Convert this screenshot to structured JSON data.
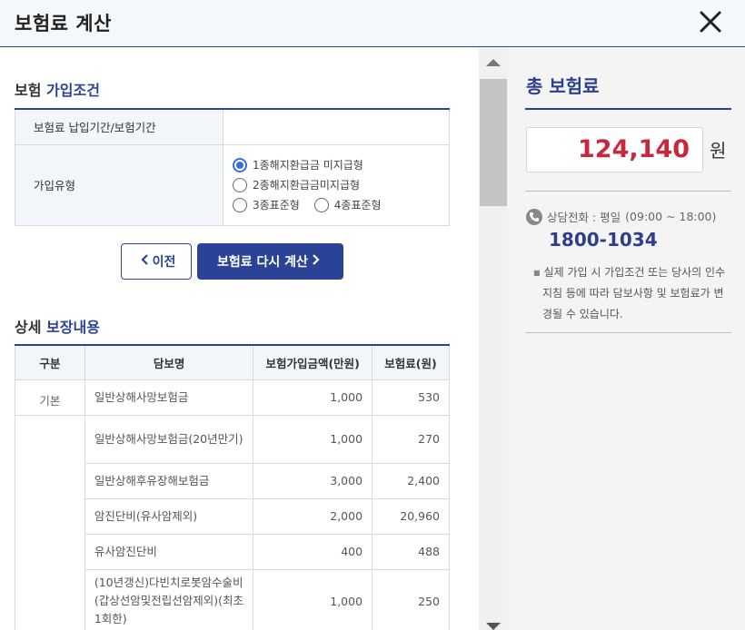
{
  "header": {
    "title": "보험료 계산"
  },
  "conditions": {
    "title_prefix": "보험",
    "title_accent": "가입조건",
    "period_label": "보험료 납입기간/보험기간",
    "period_value": "",
    "type_label": "가입유형",
    "options": [
      {
        "label": "1종해지환급금 미지급형",
        "checked": true
      },
      {
        "label": "2종해지환급금미지급형",
        "checked": false
      },
      {
        "label": "3종표준형",
        "checked": false
      },
      {
        "label": "4종표준형",
        "checked": false
      }
    ]
  },
  "buttons": {
    "prev": "이전",
    "recalc": "보험료 다시 계산"
  },
  "detail": {
    "title_prefix": "상세",
    "title_accent": "보장내용",
    "headers": [
      "구분",
      "담보명",
      "보험가입금액(만원)",
      "보험료(원)"
    ],
    "rows": [
      {
        "category": "기본",
        "name": "일반상해사망보험금",
        "amount": "1,000",
        "premium": "530"
      },
      {
        "category": "",
        "name": "일반상해사망보험금(20년만기)",
        "amount": "1,000",
        "premium": "270"
      },
      {
        "category": "",
        "name": "일반상해후유장해보험금",
        "amount": "3,000",
        "premium": "2,400"
      },
      {
        "category": "",
        "name": "암진단비(유사암제외)",
        "amount": "2,000",
        "premium": "20,960"
      },
      {
        "category": "",
        "name": "유사암진단비",
        "amount": "400",
        "premium": "488"
      },
      {
        "category": "",
        "name": "(10년갱신)다빈치로봇암수술비(갑상선암및전립선암제외)(최초1회한)",
        "amount": "1,000",
        "premium": "250"
      }
    ]
  },
  "summary": {
    "title": "총 보험료",
    "amount": "124,140",
    "unit": "원",
    "phone_label": "상담전화 : 평일",
    "phone_hours": "(09:00 ~ 18:00)",
    "phone_number": "1800-1034",
    "notice": "실제 가입 시 가입조건 또는 당사의 인수지침 등에 따라 담보사항 및 보험료가 변경될 수 있습니다."
  },
  "colors": {
    "brand": "#2b4396",
    "amount": "#c8283c",
    "radio": "#3a6fd8"
  },
  "icons": [
    "close-icon",
    "chevron-left-icon",
    "chevron-right-icon",
    "phone-icon",
    "scroll-up-icon",
    "scroll-down-icon"
  ]
}
